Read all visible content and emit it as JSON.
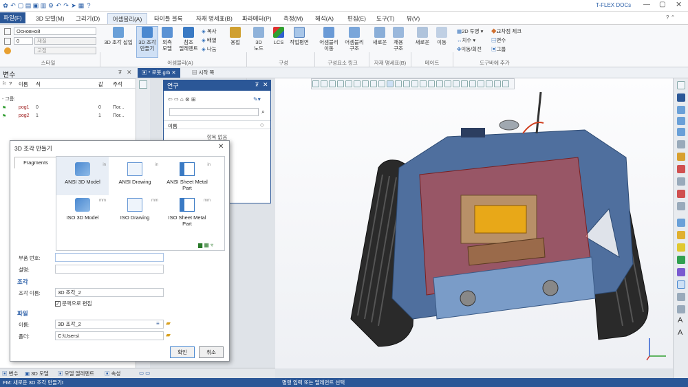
{
  "app": {
    "title": "T-FLEX DOCs"
  },
  "menu": {
    "file": "파일(F)",
    "items": [
      "3D 모델(M)",
      "그리기(D)",
      "어셈블리(A)",
      "타이틀 블록",
      "자재 명세표(B)",
      "파라메터(P)",
      "측정(M)",
      "해석(A)",
      "편집(E)",
      "도구(T)",
      "뷰(V)"
    ]
  },
  "ribbon": {
    "style": {
      "combo1": "Основной",
      "combo2_num": "0",
      "combo2_txt": "재질",
      "combo3": "고정",
      "group": "스타일"
    },
    "assembly": {
      "insert": "3D 조각 삽입",
      "create_1": "3D 조각",
      "create_2": "만들기",
      "ext_1": "외측",
      "ext_2": "모델",
      "ref_1": "참조",
      "ref_2": "엘레멘트",
      "copy": "복사",
      "array": "배열",
      "split": "나눔",
      "weld": "용접",
      "group": "어셈블리(A)"
    },
    "composition": {
      "node_1": "3D",
      "node_2": "노드",
      "lcs": "LCS",
      "plane_1": "작업평면",
      "group": "구성"
    },
    "links": {
      "move_1": "어셈블리",
      "move_2": "이동",
      "struct_1": "어셈블리",
      "struct_2": "구조",
      "group": "구성요소 링크"
    },
    "bom": {
      "new": "새로운",
      "apply_1": "채용",
      "apply_2": "구조",
      "group": "자재 명세표(B)"
    },
    "mate": {
      "new": "새로운",
      "move": "이동",
      "group": "메이트"
    },
    "toolbar": {
      "proj": "2D 투영",
      "cross": "교차점 체크",
      "dim": "치수",
      "var": "변수",
      "moverot": "이동/회전",
      "grp": "그룹",
      "group": "도구바에 추가"
    }
  },
  "variables_panel": {
    "title": "변수",
    "cols": {
      "q": "?",
      "name": "이름",
      "expr": "식",
      "value": "값",
      "comment": "주석"
    },
    "group_label": "그룹:",
    "rows": [
      {
        "name": "pog1",
        "expr": "0",
        "value": "0",
        "comment": "Пог..."
      },
      {
        "name": "pog2",
        "expr": "1",
        "value": "1",
        "comment": "Пог..."
      }
    ]
  },
  "doc_tabs": {
    "active": "* 로봇.grb",
    "start": "시작 쪽"
  },
  "research_panel": {
    "title": "연구",
    "name_label": "이름",
    "empty": "항목 없음"
  },
  "dialog": {
    "title": "3D 조각 만들기",
    "tab": "Fragments",
    "fragments": [
      {
        "label": "ANSI 3D Model",
        "badge": "in"
      },
      {
        "label": "ANSI Drawing",
        "badge": "in"
      },
      {
        "label": "ANSI Sheet Metal Part",
        "badge": "in"
      },
      {
        "label": "ISO 3D Model",
        "badge": "mm"
      },
      {
        "label": "ISO Drawing",
        "badge": "mm"
      },
      {
        "label": "ISO Sheet Metal Part",
        "badge": "mm"
      }
    ],
    "part_no_label": "부품 번호:",
    "desc_label": "설명:",
    "section_fragment": "조각",
    "frag_name_label": "조각 이름:",
    "frag_name_value": "3D 조각_2",
    "edit_in_context": "문맥으로 편집",
    "section_file": "파일",
    "file_name_label": "이름:",
    "file_name_value": "3D 조각_2",
    "folder_label": "폴더:",
    "folder_value": "C:\\Users\\",
    "ok": "확인",
    "cancel": "취소"
  },
  "bottom_tabs": [
    "변수",
    "3D 모델",
    "모델 엘레멘트",
    "속성"
  ],
  "status": {
    "left": "FM: 새로운 3D 조각 만들기t",
    "center": "명령 입력 또는 엘레먼트 선택"
  }
}
